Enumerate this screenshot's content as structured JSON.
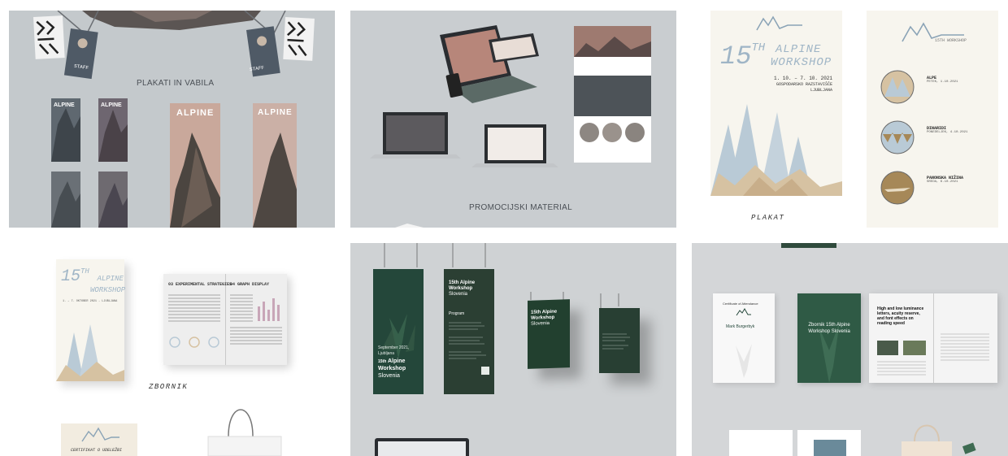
{
  "tiles": {
    "banners": {
      "caption": "PLAKATI IN VABILA",
      "badge_label": "STAFF",
      "brand": "ALPINE"
    },
    "promo": {
      "caption": "PROMOCIJSKI MATERIAL"
    },
    "poster": {
      "title": "15TH ALPINE WORKSHOP",
      "title_num": "15",
      "title_sup": "TH",
      "title_line1": "ALPINE",
      "title_line2": "WORKSHOP",
      "dates": "1. 10. – 7. 10. 2021",
      "venue_line1": "GOSPODARSKO RAZSTAVIŠČE",
      "venue_line2": "LJUBLJANA",
      "caption": "PLAKAT",
      "logo_sub": "15TH WORKSHOP",
      "program": [
        {
          "name": "ALPE",
          "date": "PETEK, 1.10.2021"
        },
        {
          "name": "DINARIDI",
          "date": "PONEDELJEK, 4.10.2021"
        },
        {
          "name": "PANONSKA NIŽINA",
          "date": "SREDA, 6.10.2021"
        }
      ]
    },
    "proceedings": {
      "cover_num": "15",
      "cover_sup": "TH",
      "cover_line1": "ALPINE",
      "cover_line2": "WORKSHOP",
      "cover_dates": "1. – 7. OKTOBER 2021 - LJUBLJANA",
      "page_left_title": "03 EXPERIMENTAL STRATEGIES",
      "page_right_title": "04 GRAPH DISPLAY",
      "caption": "ZBORNIK",
      "cert_title": "CERTIFIKAT O UDELEŽBI"
    },
    "green_posters": {
      "poster1_date": "September 2021,",
      "poster1_city": "Ljubljana",
      "poster1_title_sup": "15th",
      "poster1_title_line1": "Alpine",
      "poster1_title_line2": "Workshop",
      "poster1_country": "Slovenia",
      "poster2_title_line1": "15th Alpine",
      "poster2_title_line2": "Workshop",
      "poster2_country": "Slovenia",
      "poster2_program": "Program",
      "poster3_title_line1": "15th Alpine",
      "poster3_title_line2": "Workshop",
      "poster3_country": "Slovenia"
    },
    "stationery": {
      "cert_heading": "Certificate of Attendance",
      "cert_name": "Mark Burgerbyk",
      "book_title": "Zbornik 15th Alpine Workshop Slovenia",
      "article_title": "High and low luminance letters, acuity reserve, and font effects on reading speed"
    }
  },
  "colors": {
    "accent_blue": "#b9cad6",
    "accent_beige": "#d6c2a2",
    "accent_brown": "#a68858",
    "forest_green": "#24473a",
    "poster_bg": "#f7f5ee"
  }
}
